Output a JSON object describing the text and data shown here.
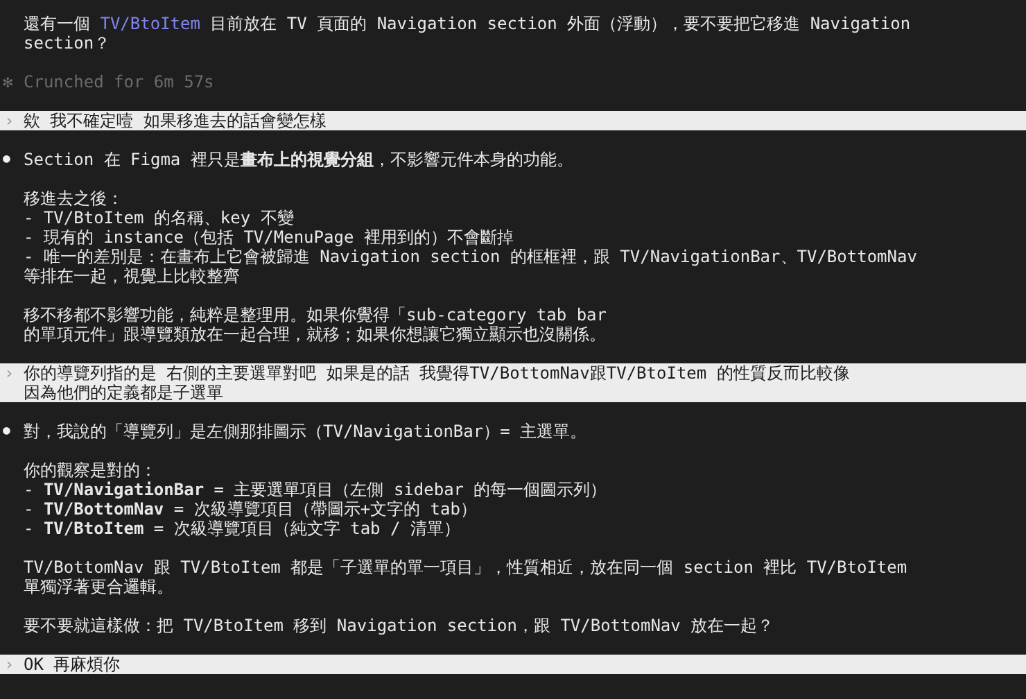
{
  "transcript": [
    {
      "kind": "text",
      "paragraphs": [
        [
          [
            {
              "t": "還有一個 ",
              "kind": "plain"
            },
            {
              "t": "TV/BtoItem",
              "kind": "ref"
            },
            {
              "t": " 目前放在 TV 頁面的 Navigation section 外面（浮動），要不要把它移進 Navigation",
              "kind": "plain"
            }
          ],
          "section？"
        ]
      ]
    },
    {
      "kind": "status",
      "symbol": "✻",
      "text": "Crunched for 6m 57s"
    },
    {
      "kind": "prompt",
      "marker": "›",
      "lines": [
        "欸 我不確定噎 如果移進去的話會變怎樣"
      ]
    },
    {
      "kind": "reply",
      "bullet": "●",
      "paragraphs": [
        [
          "Section 在 Figma 裡只是**畫布上的視覺分組**，不影響元件本身的功能。"
        ],
        [
          "移進去之後：",
          "- TV/BtoItem 的名稱、key 不變",
          "- 現有的 instance（包括 TV/MenuPage 裡用到的）不會斷掉",
          "- 唯一的差別是：在畫布上它會被歸進 Navigation section 的框框裡，跟 TV/NavigationBar、TV/BottomNav",
          "等排在一起，視覺上比較整齊"
        ],
        [
          "移不移都不影響功能，純粹是整理用。如果你覺得「sub-category tab bar",
          "的單項元件」跟導覽類放在一起合理，就移；如果你想讓它獨立顯示也沒關係。"
        ]
      ]
    },
    {
      "kind": "prompt",
      "marker": "›",
      "lines": [
        "你的導覽列指的是 右側的主要選單對吧 如果是的話 我覺得TV/BottomNav跟TV/BtoItem 的性質反而比較像",
        "因為他們的定義都是子選單"
      ]
    },
    {
      "kind": "reply",
      "bullet": "●",
      "paragraphs": [
        [
          "對，我說的「導覽列」是左側那排圖示（TV/NavigationBar）= 主選單。"
        ],
        [
          "你的觀察是對的：",
          "- **TV/NavigationBar** = 主要選單項目（左側 sidebar 的每一個圖示列）",
          "- **TV/BottomNav** = 次級導覽項目（帶圖示+文字的 tab）",
          "- **TV/BtoItem** = 次級導覽項目（純文字 tab / 清單）"
        ],
        [
          "TV/BottomNav 跟 TV/BtoItem 都是「子選單的單一項目」，性質相近，放在同一個 section 裡比 TV/BtoItem",
          "單獨浮著更合邏輯。"
        ],
        [
          "要不要就這樣做：把 TV/BtoItem 移到 Navigation section，跟 TV/BottomNav 放在一起？"
        ]
      ]
    },
    {
      "kind": "prompt",
      "marker": "›",
      "lines": [
        "OK 再麻煩你"
      ]
    }
  ]
}
